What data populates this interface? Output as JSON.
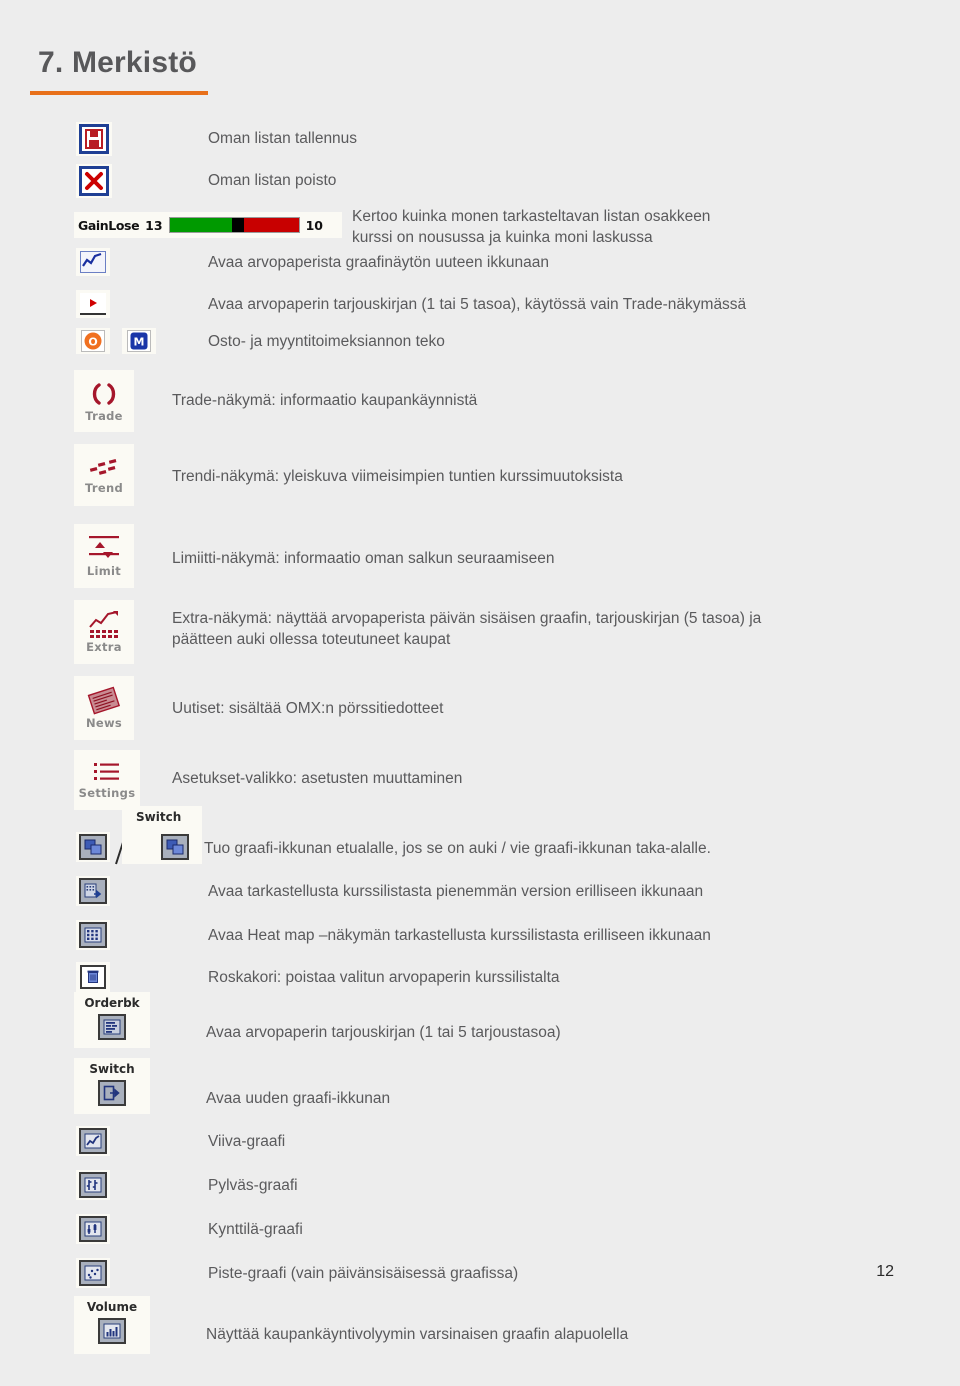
{
  "document": {
    "heading": "7. Merkistö",
    "page_number": "12",
    "accent_color": "#e8701a",
    "background_color": "#ededed",
    "text_color": "#5a5a5c"
  },
  "gainlose": {
    "label": "GainLose",
    "gain_count": "13",
    "lose_count": "10",
    "gain_color": "#009a00",
    "divider_color": "#000000",
    "lose_color": "#c80000"
  },
  "legend": {
    "rows": [
      {
        "icon": "save-floppy-icon",
        "icon_label": "",
        "description": "Oman listan tallennus"
      },
      {
        "icon": "delete-x-icon",
        "icon_label": "",
        "description": "Oman listan poisto"
      },
      {
        "icon": "gainlose-bar-widget",
        "icon_label": "",
        "description": "Kertoo kuinka monen tarkasteltavan listan osakkeen\nkurssi on nousussa ja kuinka moni laskussa"
      },
      {
        "icon": "line-chart-icon",
        "icon_label": "",
        "description": "Avaa arvopaperista graafinäytön uuteen ikkunaan"
      },
      {
        "icon": "orderbook-arrow-icon",
        "icon_label": "",
        "description": "Avaa arvopaperin tarjouskirjan (1 tai 5 tasoa), käytössä vain Trade-näkymässä"
      },
      {
        "icon": "buy-sell-om-icon",
        "icon_label": "",
        "description": "Osto- ja myyntitoimeksiannon teko"
      },
      {
        "icon": "trade-icon",
        "icon_label": "Trade",
        "description": "Trade-näkymä: informaatio kaupankäynnistä"
      },
      {
        "icon": "trend-icon",
        "icon_label": "Trend",
        "description": "Trendi-näkymä: yleiskuva viimeisimpien tuntien kurssimuutoksista"
      },
      {
        "icon": "limit-icon",
        "icon_label": "Limit",
        "description": "Limiitti-näkymä: informaatio oman salkun seuraamiseen"
      },
      {
        "icon": "extra-icon",
        "icon_label": "Extra",
        "description": "Extra-näkymä:  näyttää arvopaperista päivän sisäisen graafin, tarjouskirjan (5 tasoa) ja\npäätteen auki ollessa toteutuneet kaupat"
      },
      {
        "icon": "news-icon",
        "icon_label": "News",
        "description": "Uutiset: sisältää OMX:n pörssitiedotteet"
      },
      {
        "icon": "settings-icon",
        "icon_label": "Settings",
        "description": "Asetukset-valikko: asetusten muuttaminen"
      },
      {
        "icon": "switch-window-icon",
        "icon_label": "Switch",
        "description": "Tuo graafi-ikkunan etualalle, jos se on auki / vie graafi-ikkunan taka-alalle."
      },
      {
        "icon": "small-window-icon",
        "icon_label": "",
        "description": "Avaa tarkastellusta kurssilistasta pienemmän version erilliseen ikkunaan"
      },
      {
        "icon": "heatmap-icon",
        "icon_label": "",
        "description": "Avaa Heat map –näkymän tarkastellusta kurssilistasta erilliseen ikkunaan"
      },
      {
        "icon": "trash-icon",
        "icon_label": "",
        "description": "Roskakori: poistaa valitun arvopaperin kurssilistalta"
      },
      {
        "icon": "orderbook-icon",
        "icon_label": "Orderbk",
        "description": "Avaa arvopaperin tarjouskirjan (1 tai 5 tarjoustasoa)"
      },
      {
        "icon": "new-graph-window-icon",
        "icon_label": "Switch",
        "description": "Avaa uuden graafi-ikkunan"
      },
      {
        "icon": "line-graph-icon",
        "icon_label": "",
        "description": "Viiva-graafi"
      },
      {
        "icon": "bar-graph-icon",
        "icon_label": "",
        "description": "Pylväs-graafi"
      },
      {
        "icon": "candlestick-graph-icon",
        "icon_label": "",
        "description": "Kynttilä-graafi"
      },
      {
        "icon": "scatter-graph-icon",
        "icon_label": "",
        "description": "Piste-graafi (vain päivänsisäisessä graafissa)"
      },
      {
        "icon": "volume-icon",
        "icon_label": "Volume",
        "description": "Näyttää kaupankäyntivolyymin varsinaisen graafin alapuolella"
      }
    ]
  }
}
